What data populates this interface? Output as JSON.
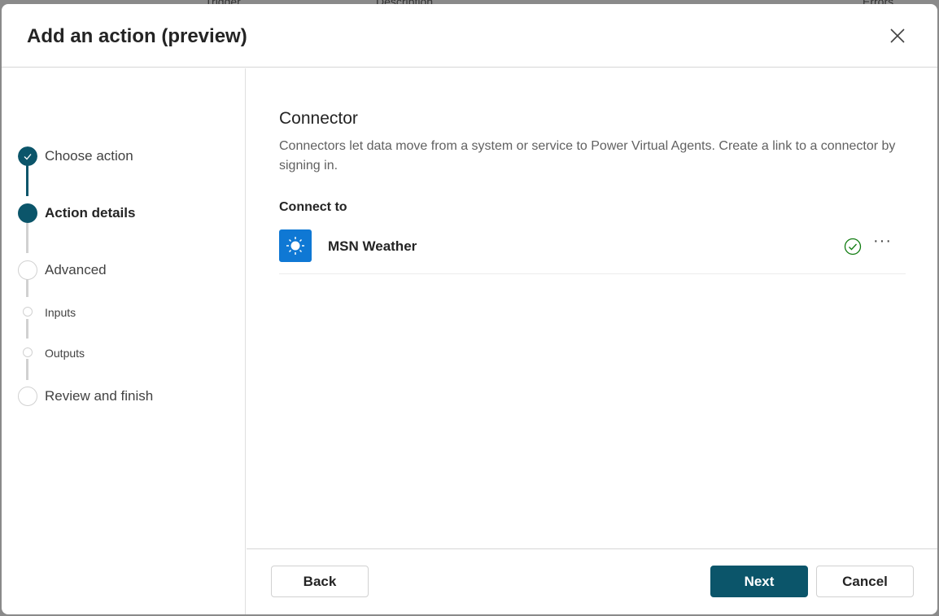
{
  "background": {
    "columns": [
      "Trigger",
      "Description",
      "Errors"
    ]
  },
  "dialog": {
    "title": "Add an action (preview)",
    "close_icon": "close-icon"
  },
  "steps": [
    {
      "label": "Choose action",
      "state": "completed"
    },
    {
      "label": "Action details",
      "state": "current"
    },
    {
      "label": "Advanced",
      "state": "pending"
    },
    {
      "label": "Inputs",
      "state": "pending-substep"
    },
    {
      "label": "Outputs",
      "state": "pending-substep"
    },
    {
      "label": "Review and finish",
      "state": "pending"
    }
  ],
  "content": {
    "heading": "Connector",
    "description": "Connectors let data move from a system or service to Power Virtual Agents. Create a link to a connector by signing in.",
    "connect_to_label": "Connect to",
    "connector": {
      "name": "MSN Weather",
      "icon": "sun-icon",
      "status": "connected",
      "more_label": "···"
    }
  },
  "footer": {
    "back": "Back",
    "next": "Next",
    "cancel": "Cancel"
  },
  "colors": {
    "primary": "#0b556a",
    "connector_icon_bg": "#0f78d4",
    "success": "#107c10"
  }
}
